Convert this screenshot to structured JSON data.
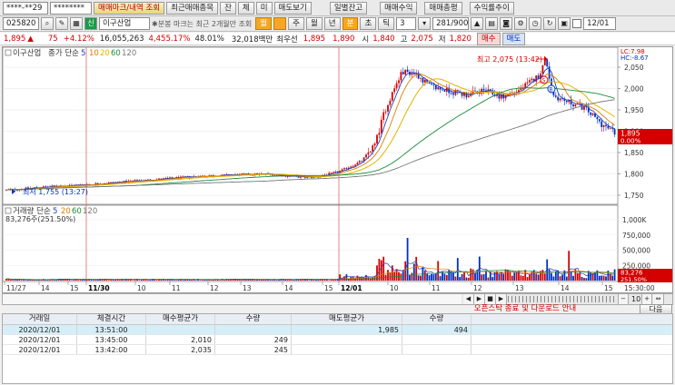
{
  "toolbar1": {
    "account": "****-**29",
    "password": "********",
    "buttons": [
      "매매마크/내역 조회",
      "최근매매종목",
      "잔",
      "체",
      "미",
      "매도보기",
      "일별잔고",
      "매매수익",
      "매매총평",
      "수익률추이"
    ],
    "date": "12/01"
  },
  "toolbar2": {
    "code": "025820",
    "stock_badge": "신",
    "stock_name": "이구산업",
    "hint": "분봉 마크는 최근 2개월만 조회",
    "periods": [
      "월",
      "",
      "주",
      "월",
      "년",
      "분",
      "초",
      "틱"
    ],
    "interval_value": "3",
    "count": "281/900"
  },
  "quote": {
    "price": "1,895",
    "change": "75",
    "change_pct": "+4.12%",
    "volume": "16,055,263",
    "vol_ratio": "4,455.17%",
    "turnover": "48.01%",
    "amount": "32,018백만",
    "best_bid_label": "최우선",
    "best_bid1": "1,895",
    "best_bid2": "1,890",
    "open_label": "시",
    "open": "1,840",
    "high_label": "고",
    "high": "2,075",
    "low_label": "저",
    "low": "1,820",
    "buy_btn": "매수",
    "sell_btn": "매도"
  },
  "chart": {
    "stock_label": "이구산업",
    "price_legend": {
      "label": "종가 단순",
      "ma": [
        "5",
        "10",
        "20",
        "60",
        "120"
      ]
    },
    "vol_legend": {
      "label": "거래량 단순",
      "ma": [
        "5",
        "20",
        "60",
        "120"
      ]
    },
    "vol_value": "83,276주(251.50%)",
    "lc": "LC:7.98",
    "hc": "HC:-8.67",
    "high_annot": "최고 2,075 (13:42)",
    "low_annot": "최저 1,755 (13:27)",
    "badge_s": "S",
    "badge_b": "B",
    "price_ticks": [
      "2,050",
      "2,000",
      "1,950",
      "1,900",
      "1,850",
      "1,800",
      "1,750"
    ],
    "vol_ticks": [
      "1,000K",
      "750,000",
      "500,000",
      "250,000"
    ],
    "cur_price_tag": "1,895",
    "cur_pct_tag": "0.00%",
    "vol_tag1": "83,276",
    "vol_tag2": "251.50%",
    "x_labels": [
      "11/27",
      "14",
      "15",
      "11/30",
      "10",
      "11",
      "12",
      "13",
      "14",
      "15",
      "12/01",
      "10",
      "11",
      "12",
      "13",
      "14",
      "15"
    ],
    "time_label": "15:30:00",
    "scroll_count": "10"
  },
  "notice": "오픈스탁 종료 및 다운로드 안내",
  "next_btn": "다음",
  "grid": {
    "headers": [
      "거래일",
      "체결시간",
      "매수평균가",
      "수량",
      "매도평균가",
      "수량"
    ],
    "rows": [
      [
        "2020/12/01",
        "13:51:00",
        "",
        "",
        "1,985",
        "494"
      ],
      [
        "2020/12/01",
        "13:45:00",
        "2,010",
        "249",
        "",
        ""
      ],
      [
        "2020/12/01",
        "13:42:00",
        "2,035",
        "245",
        "",
        ""
      ]
    ]
  },
  "colors": {
    "up": "#d40000",
    "down": "#0030c0",
    "ma5": "#1f3fbf",
    "ma10": "#e07b00",
    "ma20": "#e0b400",
    "ma60": "#1a8a3a",
    "ma120": "#777777"
  }
}
